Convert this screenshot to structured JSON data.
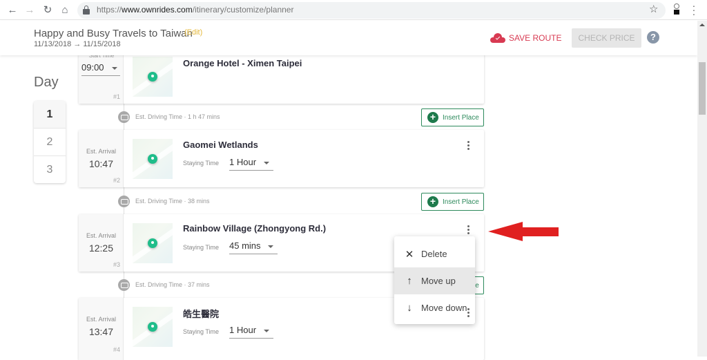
{
  "browser": {
    "url_prefix": "https://",
    "url_domain": "www.ownrides.com",
    "url_path": "/itinerary/customize/planner",
    "icons": [
      "back-icon",
      "forward-icon",
      "reload-icon",
      "home-icon",
      "lock-icon",
      "bookmark-star-icon",
      "extension-icon",
      "browser-menu-icon"
    ]
  },
  "header": {
    "trip_title": "Happy and Busy Travels to Taiwan",
    "edit_label": "(Edit)",
    "start_date": "11/13/2018",
    "end_date": "11/15/2018",
    "date_arrow": "→",
    "save_route_label": "SAVE ROUTE",
    "check_price_label": "CHECK PRICE",
    "help_label": "?"
  },
  "days": {
    "label": "Day",
    "items": [
      "1",
      "2",
      "3"
    ],
    "active": "1"
  },
  "stops": [
    {
      "index": "#1",
      "time_label": "Start Time",
      "time": "09:00",
      "place": "Orange Hotel - Ximen Taipei"
    },
    {
      "index": "#2",
      "time_label": "Est. Arrival",
      "time": "10:47",
      "place": "Gaomei Wetlands",
      "staying_label": "Staying Time",
      "staying_time": "1 Hour"
    },
    {
      "index": "#3",
      "time_label": "Est. Arrival",
      "time": "12:25",
      "place": "Rainbow Village (Zhongyong Rd.)",
      "staying_label": "Staying Time",
      "staying_time": "45 mins"
    },
    {
      "index": "#4",
      "time_label": "Est. Arrival",
      "time": "13:47",
      "place": "皓生醫院",
      "staying_label": "Staying Time",
      "staying_time": "1 Hour"
    }
  ],
  "drives": [
    {
      "label": "Est. Driving Time · 1 h 47 mins"
    },
    {
      "label": "Est. Driving Time · 38 mins"
    },
    {
      "label": "Est. Driving Time · 37 mins"
    }
  ],
  "insert_place_label": "Insert Place",
  "context_menu": {
    "items": [
      {
        "icon": "close-icon",
        "glyph": "✕",
        "label": "Delete"
      },
      {
        "icon": "arrow-up-icon",
        "glyph": "↑",
        "label": "Move up"
      },
      {
        "icon": "arrow-down-icon",
        "glyph": "↓",
        "label": "Move down"
      }
    ],
    "hovered": "Move up"
  },
  "colors": {
    "accent_green": "#1e7a4c",
    "save_red": "#d83a52",
    "edit_yellow": "#e5b93c",
    "pin_teal": "#1fbd8a",
    "annotation_red": "#e02020"
  }
}
